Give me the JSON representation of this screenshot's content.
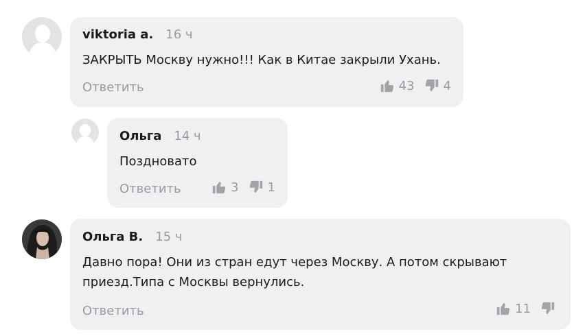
{
  "comments": [
    {
      "author": "viktoria a.",
      "time": "16 ч",
      "text": "ЗАКРЫТЬ  Москву нужно!!! Как в Китае закрыли Ухань.",
      "reply": "Ответить",
      "likes": "43",
      "dislikes": "4"
    },
    {
      "author": "Ольга",
      "time": "14 ч",
      "text": "Поздновато",
      "reply": "Ответить",
      "likes": "3",
      "dislikes": "1"
    },
    {
      "author": "Ольга В.",
      "time": "15 ч",
      "text_line1": "Давно пора! Они из стран едут через Москву. А потом скрывают",
      "text_line2": "приезд.Типа с Москвы вернулись.",
      "reply": "Ответить",
      "likes": "11",
      "dislikes": ""
    }
  ],
  "icons": {
    "like": "thumbs-up-icon",
    "dislike": "thumbs-down-icon",
    "default_avatar": "user-silhouette-icon"
  },
  "colors": {
    "bubble": "#f0f0f2",
    "muted": "#9a9aa0",
    "text": "#1a1a1a"
  }
}
